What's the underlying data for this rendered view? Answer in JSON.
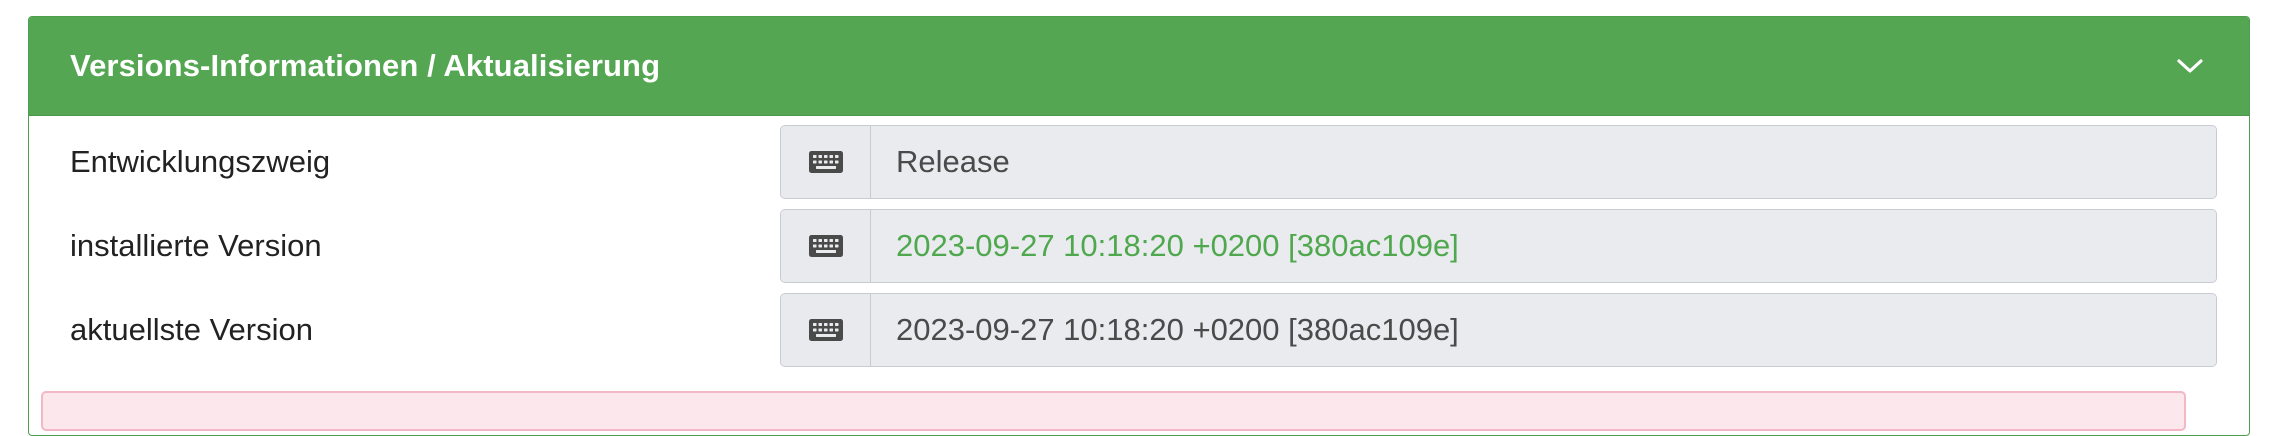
{
  "panel": {
    "title": "Versions-Informationen / Aktualisierung"
  },
  "rows": [
    {
      "label": "Entwicklungszweig",
      "value": "Release",
      "icon": "keyboard-icon",
      "value_color": "#4a4a4a"
    },
    {
      "label": "installierte Version",
      "value": "2023-09-27 10:18:20 +0200 [380ac109e]",
      "icon": "keyboard-icon",
      "value_color": "#4fa84e"
    },
    {
      "label": "aktuellste Version",
      "value": "2023-09-27 10:18:20 +0200 [380ac109e]",
      "icon": "keyboard-icon",
      "value_color": "#4a4a4a"
    }
  ],
  "colors": {
    "header_bg": "#54a652",
    "installed_version_text": "#4fa84e",
    "alert_border": "#f2b8c6"
  }
}
